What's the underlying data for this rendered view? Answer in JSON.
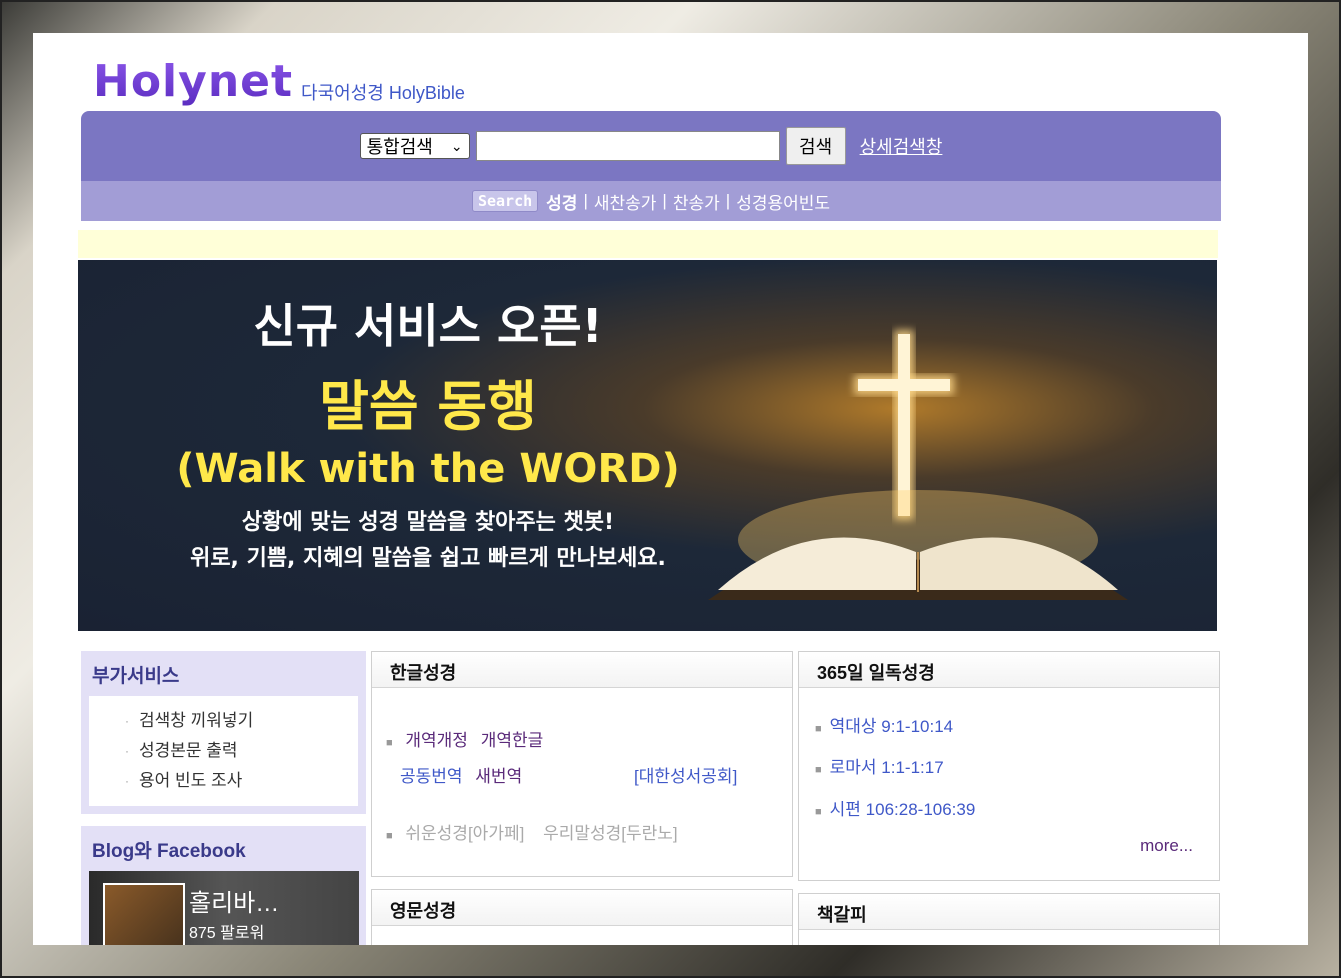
{
  "header": {
    "logo": "Holynet",
    "subtitle": "다국어성경 HolyBible"
  },
  "search": {
    "select_value": "통합검색",
    "input_value": "",
    "button_label": "검색",
    "advanced_link": "상세검색창",
    "tag": "Search",
    "nav": [
      "성경",
      "새찬송가",
      "찬송가",
      "성경용어빈도"
    ],
    "separator": "|"
  },
  "banner": {
    "line1": "신규 서비스 오픈!",
    "line2": "말씀 동행",
    "line3": "(Walk with the WORD)",
    "line4": "상황에 맞는 성경 말씀을 찾아주는 챗봇!",
    "line5": "위로, 기쁨, 지혜의 말씀을 쉽고 빠르게 만나보세요."
  },
  "sidebar": {
    "title": "부가서비스",
    "items": [
      "검색창 끼워넣기",
      "성경본문 출력",
      "용어 빈도 조사"
    ],
    "blog_title": "Blog와 Facebook",
    "fb_name": "홀리바…",
    "fb_followers": "875 팔로워"
  },
  "korean_bible": {
    "title": "한글성경",
    "row1": [
      "개역개정",
      "개역한글"
    ],
    "row2": [
      "공동번역",
      "새번역"
    ],
    "publisher": "[대한성서공회]",
    "row3": [
      "쉬운성경[아가페]",
      "우리말성경[두란노]"
    ]
  },
  "daily_reading": {
    "title": "365일 일독성경",
    "items": [
      "역대상 9:1-10:14",
      "로마서 1:1-1:17",
      "시편 106:28-106:39"
    ],
    "more": "more..."
  },
  "english_bible": {
    "title": "영문성경"
  },
  "bookmark": {
    "title": "책갈피"
  },
  "colors": {
    "search_bar": "#7b76c2",
    "search_nav": "#a29dd6",
    "sidebar_bg": "#e3e0f6",
    "link_blue": "#3f58c8",
    "link_purple": "#5a2a7a",
    "banner_yellow": "#ffe84a"
  }
}
